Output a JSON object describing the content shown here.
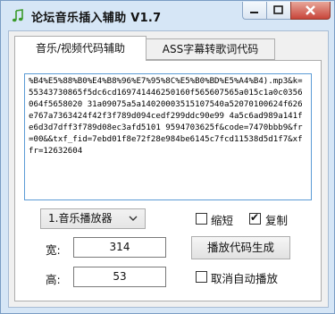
{
  "window": {
    "title": "论坛音乐插入辅助 V1.7",
    "icon": "music-note-icon"
  },
  "tabs": [
    {
      "label": "音乐/视频代码辅助",
      "active": true
    },
    {
      "label": "ASS字幕转歌词代码",
      "active": false
    }
  ],
  "code_text": "%B4%E5%88%B0%E4%B8%96%E7%95%8C%E5%B0%BD%E5%A4%B4).mp3&k=55343730865f5dc6cd169741446250160f565607565a015c1a0c0356064f5658020 31a09075a5a14020003515107540a52070100624f626e767a7363424f42f3f789d094cedf299ddc90e99 4a5c6ad989a141fe6d3d7dff3f789d08ec3afd5101 9594703625f&code=7470bbb9&fr=00&&txf_fid=7ebd01f8e72f28e984be6145c7fcd11538d5d1f7&xffr=12632604",
  "player_select": {
    "value": "1.音乐播放器"
  },
  "checkboxes": {
    "shorten": {
      "label": "缩短",
      "checked": false
    },
    "copy": {
      "label": "复制",
      "checked": true
    },
    "cancel_autoplay": {
      "label": "取消自动播放",
      "checked": false
    }
  },
  "width": {
    "label": "宽:",
    "value": "314"
  },
  "height": {
    "label": "高:",
    "value": "53"
  },
  "generate_button": "播放代码生成"
}
